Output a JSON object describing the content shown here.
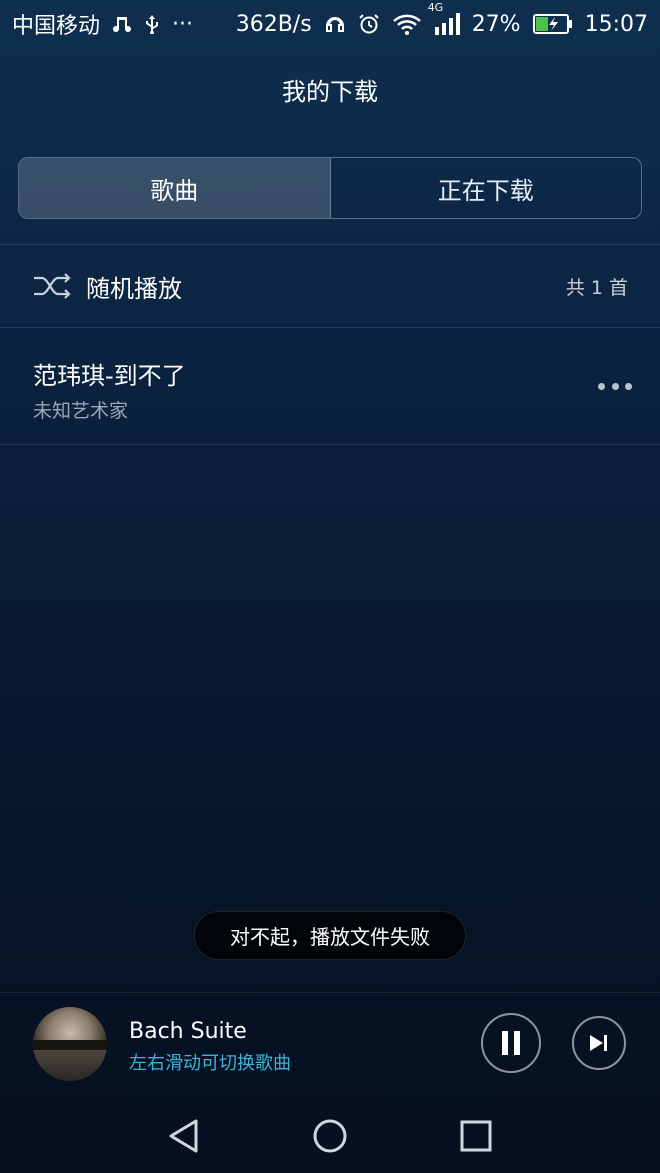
{
  "status_bar": {
    "carrier": "中国移动",
    "speed": "362B/s",
    "battery_percent": "27%",
    "time": "15:07",
    "network_type": "4G",
    "more_dots": "···",
    "icons": [
      "music-note-icon",
      "usb-icon",
      "headphones-icon",
      "alarm-icon",
      "wifi-icon",
      "signal-icon",
      "battery-charging-icon"
    ]
  },
  "header": {
    "title": "我的下载"
  },
  "tabs": [
    {
      "label": "歌曲",
      "active": true
    },
    {
      "label": "正在下载",
      "active": false
    }
  ],
  "shuffle": {
    "label": "随机播放",
    "count": "共 1 首",
    "icon": "shuffle-icon"
  },
  "songs": [
    {
      "title": "范玮琪-到不了",
      "artist": "未知艺术家"
    }
  ],
  "toast": {
    "message": "对不起，播放文件失败"
  },
  "player": {
    "title": "Bach Suite",
    "subtitle": "左右滑动可切换歌曲",
    "is_playing": true
  },
  "nav": {
    "icons": [
      "back-icon",
      "home-icon",
      "recents-icon"
    ]
  },
  "colors": {
    "accent": "#3bb4d6",
    "background_top": "#0f2f4f",
    "background_bottom": "#060f1f"
  }
}
